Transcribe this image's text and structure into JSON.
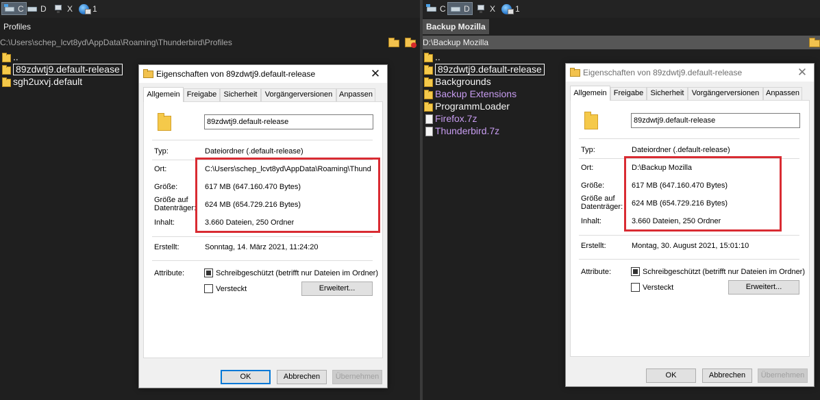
{
  "left_pane": {
    "drives": [
      {
        "letter": "C",
        "icon": "system-drive-icon",
        "active": true
      },
      {
        "letter": "D",
        "icon": "drive-icon",
        "active": false
      },
      {
        "letter": "X",
        "icon": "network-drive-icon",
        "active": false
      },
      {
        "letter": "1",
        "icon": "globe-network-icon",
        "active": false
      }
    ],
    "tab": "Profiles",
    "path": "C:\\Users\\schep_lcvt8yd\\AppData\\Roaming\\Thunderbird\\Profiles",
    "files": [
      {
        "name": "..",
        "type": "folder"
      },
      {
        "name": "89zdwtj9.default-release",
        "type": "folder",
        "selected": true
      },
      {
        "name": "sgh2uxvj.default",
        "type": "folder"
      }
    ]
  },
  "right_pane": {
    "drives": [
      {
        "letter": "C",
        "icon": "system-drive-icon",
        "active": false
      },
      {
        "letter": "D",
        "icon": "drive-icon",
        "active": true
      },
      {
        "letter": "X",
        "icon": "network-drive-icon",
        "active": false
      },
      {
        "letter": "1",
        "icon": "globe-network-icon",
        "active": false
      }
    ],
    "tab": "Backup Mozilla",
    "path": "D:\\Backup Mozilla",
    "files": [
      {
        "name": "..",
        "type": "folder"
      },
      {
        "name": "89zdwtj9.default-release",
        "type": "folder",
        "selected": true
      },
      {
        "name": "Backgrounds",
        "type": "folder"
      },
      {
        "name": "Backup Extensions",
        "type": "folder",
        "color": "violet"
      },
      {
        "name": "ProgrammLoader",
        "type": "folder"
      },
      {
        "name": "Firefox.7z",
        "type": "file",
        "color": "violet"
      },
      {
        "name": "Thunderbird.7z",
        "type": "file",
        "color": "violet"
      }
    ]
  },
  "dialog_left": {
    "title": "Eigenschaften von 89zdwtj9.default-release",
    "tabs": [
      "Allgemein",
      "Freigabe",
      "Sicherheit",
      "Vorgängerversionen",
      "Anpassen"
    ],
    "name": "89zdwtj9.default-release",
    "typ_label": "Typ:",
    "typ": "Dateiordner (.default-release)",
    "ort_label": "Ort:",
    "ort": "C:\\Users\\schep_lcvt8yd\\AppData\\Roaming\\Thund",
    "groesse_label": "Größe:",
    "groesse": "617 MB (647.160.470 Bytes)",
    "groesse_datentraeger_label_1": "Größe auf",
    "groesse_datentraeger_label_2": "Datenträger:",
    "groesse_datentraeger": "624 MB (654.729.216 Bytes)",
    "inhalt_label": "Inhalt:",
    "inhalt": "3.660 Dateien, 250 Ordner",
    "erstellt_label": "Erstellt:",
    "erstellt": "Sonntag, 14. März 2021, 11:24:20",
    "attribute_label": "Attribute:",
    "schreibgeschuetzt": "Schreibgeschützt (betrifft nur Dateien im Ordner)",
    "versteckt": "Versteckt",
    "erweitert": "Erweitert...",
    "ok": "OK",
    "abbrechen": "Abbrechen",
    "uebernehmen": "Übernehmen"
  },
  "dialog_right": {
    "title": "Eigenschaften von 89zdwtj9.default-release",
    "tabs": [
      "Allgemein",
      "Freigabe",
      "Sicherheit",
      "Vorgängerversionen",
      "Anpassen"
    ],
    "name": "89zdwtj9.default-release",
    "typ_label": "Typ:",
    "typ": "Dateiordner (.default-release)",
    "ort_label": "Ort:",
    "ort": "D:\\Backup Mozilla",
    "groesse_label": "Größe:",
    "groesse": "617 MB (647.160.470 Bytes)",
    "groesse_datentraeger_label_1": "Größe auf",
    "groesse_datentraeger_label_2": "Datenträger:",
    "groesse_datentraeger": "624 MB (654.729.216 Bytes)",
    "inhalt_label": "Inhalt:",
    "inhalt": "3.660 Dateien, 250 Ordner",
    "erstellt_label": "Erstellt:",
    "erstellt": "Montag, 30. August 2021, 15:01:10",
    "attribute_label": "Attribute:",
    "schreibgeschuetzt": "Schreibgeschützt (betrifft nur Dateien im Ordner)",
    "versteckt": "Versteckt",
    "erweitert": "Erweitert...",
    "ok": "OK",
    "abbrechen": "Abbrechen",
    "uebernehmen": "Übernehmen"
  },
  "colors": {
    "highlight_frame": "#d92b32",
    "folder": "#f5c94a",
    "violet_entry": "#c79cf0",
    "pane_background": "#1f1f1f"
  }
}
